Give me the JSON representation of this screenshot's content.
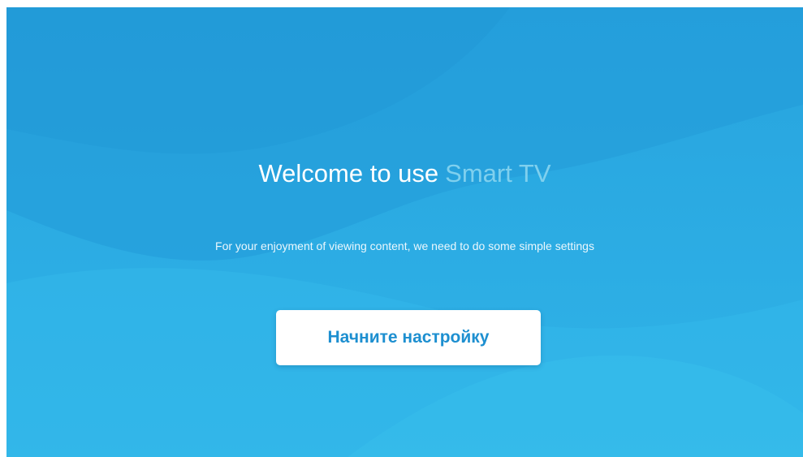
{
  "welcome": {
    "lead_text": "Welcome to use",
    "brand_text": "Smart TV"
  },
  "subtitle": "For your enjoyment of viewing content, we need to do some simple settings",
  "start_button": {
    "label": "Начните настройку"
  },
  "colors": {
    "background": "#2aa8e0",
    "brand_text": "#7fd0ee",
    "button_text": "#1d8fd0",
    "button_background": "#ffffff"
  }
}
